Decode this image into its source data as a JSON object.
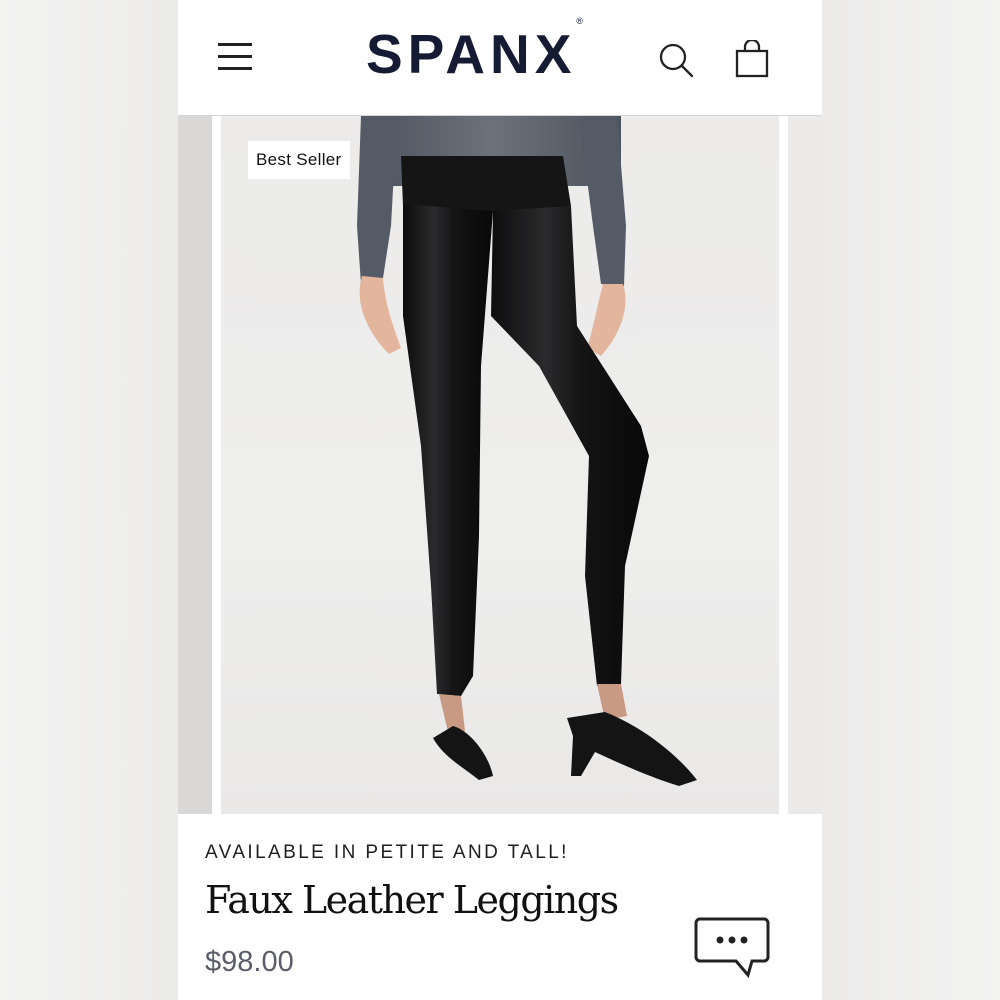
{
  "brand": {
    "logo_text": "SPANX",
    "logo_mark": "®",
    "text_color": "#141b33"
  },
  "header": {
    "menu_icon": "hamburger-menu-icon",
    "search_icon": "search-icon",
    "cart_icon": "shopping-bag-icon"
  },
  "product": {
    "badge": "Best Seller",
    "availability": "AVAILABLE IN PETITE AND TALL!",
    "name": "Faux Leather Leggings",
    "price": "$98.00"
  },
  "chat": {
    "icon": "chat-bubble-icon"
  }
}
